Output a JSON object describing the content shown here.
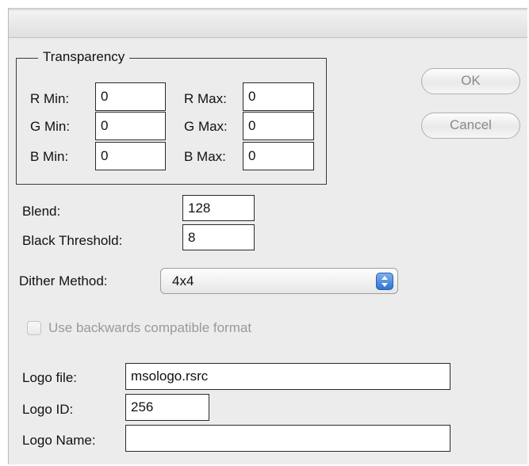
{
  "transparency": {
    "title": "Transparency",
    "r_min": {
      "label": "R Min:",
      "value": "0"
    },
    "r_max": {
      "label": "R Max:",
      "value": "0"
    },
    "g_min": {
      "label": "G Min:",
      "value": "0"
    },
    "g_max": {
      "label": "G Max:",
      "value": "0"
    },
    "b_min": {
      "label": "B Min:",
      "value": "0"
    },
    "b_max": {
      "label": "B Max:",
      "value": "0"
    }
  },
  "buttons": {
    "ok": "OK",
    "cancel": "Cancel"
  },
  "blend": {
    "label": "Blend:",
    "value": "128"
  },
  "black_threshold": {
    "label": "Black Threshold:",
    "value": "8"
  },
  "dither": {
    "label": "Dither Method:",
    "selected": "4x4"
  },
  "compat": {
    "label": "Use backwards compatible format",
    "checked": false,
    "enabled": false
  },
  "logo": {
    "file_label": "Logo file:",
    "file_value": "msologo.rsrc",
    "id_label": "Logo ID:",
    "id_value": "256",
    "name_label": "Logo Name:",
    "name_value": ""
  },
  "colors": {
    "stepper": "#2f73d6",
    "disabled_text": "#9a9a9a"
  }
}
